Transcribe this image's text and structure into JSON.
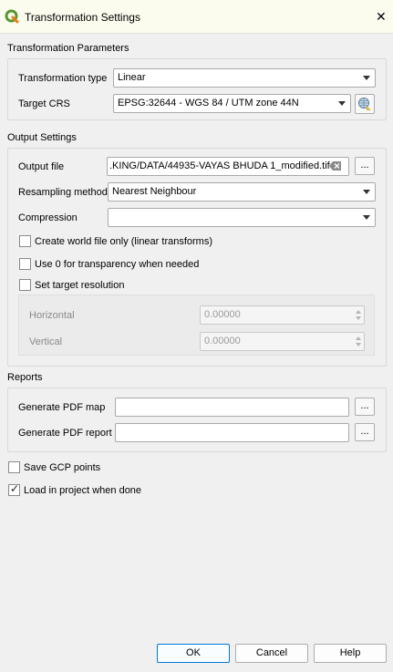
{
  "window": {
    "title": "Transformation Settings",
    "close_glyph": "✕",
    "app_icon": "qgis-logo-icon"
  },
  "transformation_parameters": {
    "group_title": "Transformation Parameters",
    "type_label": "Transformation type",
    "type_value": "Linear",
    "crs_label": "Target CRS",
    "crs_value": "EPSG:32644 - WGS 84 / UTM zone 44N",
    "crs_button_icon": "crs-globe-icon"
  },
  "output_settings": {
    "group_title": "Output Settings",
    "output_file_label": "Output file",
    "output_file_value": ".KING/DATA/44935-VAYAS BHUDA 1_modified.tif",
    "clear_glyph": "⌫",
    "browse_label": "...",
    "resampling_label": "Resampling method",
    "resampling_value": "Nearest Neighbour",
    "compression_label": "Compression",
    "compression_value": "",
    "world_file_label": "Create world file only (linear transforms)",
    "world_file_checked": false,
    "transparency_label": "Use 0 for transparency when needed",
    "transparency_checked": false,
    "target_res_label": "Set target resolution",
    "target_res_checked": false,
    "horizontal_label": "Horizontal",
    "horizontal_value": "0.00000",
    "vertical_label": "Vertical",
    "vertical_value": "0.00000"
  },
  "reports": {
    "group_title": "Reports",
    "pdf_map_label": "Generate PDF map",
    "pdf_map_value": "",
    "pdf_report_label": "Generate PDF report",
    "pdf_report_value": "",
    "browse_label": "..."
  },
  "options": {
    "save_gcp_label": "Save GCP points",
    "save_gcp_checked": false,
    "load_project_label": "Load in project when done",
    "load_project_checked": true,
    "check_glyph": "✓"
  },
  "buttons": {
    "ok": "OK",
    "cancel": "Cancel",
    "help": "Help"
  },
  "colors": {
    "title_bar": "#fbfcee",
    "dialog_bg": "#f0f0f0",
    "default_button_border": "#0078d7",
    "qgis_green": "#589632",
    "qgis_yellow": "#ee7913"
  }
}
